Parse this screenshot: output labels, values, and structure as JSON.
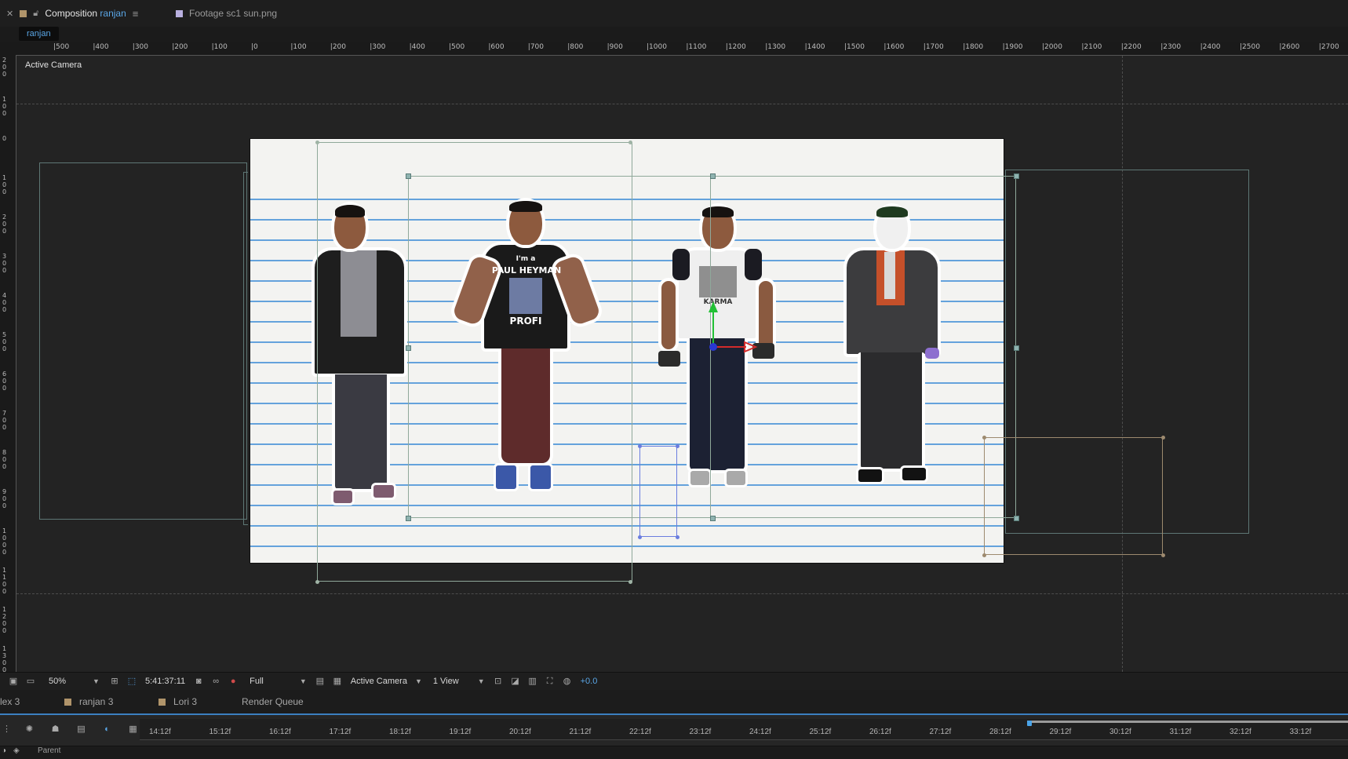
{
  "tabs": {
    "composition": {
      "prefix": "Composition",
      "name": "ranjan",
      "color": "#b0946a"
    },
    "footage": {
      "label": "Footage sc1 sun.png",
      "color": "#b9b0e0"
    }
  },
  "breadcrumb": "ranjan",
  "viewer": {
    "camera_label": "Active Camera",
    "hruler_labels": [
      "500",
      "400",
      "300",
      "200",
      "100",
      "0",
      "100",
      "200",
      "300",
      "400",
      "500",
      "600",
      "700",
      "800",
      "900",
      "1000",
      "1100",
      "1200",
      "1300",
      "1400",
      "1500",
      "1600",
      "1700",
      "1800",
      "1900",
      "2000",
      "2100",
      "2200",
      "2300",
      "2400",
      "2500",
      "2600",
      "2700"
    ],
    "vruler_labels": [
      "200",
      "100",
      "0",
      "100",
      "200",
      "300",
      "400",
      "500",
      "600",
      "700",
      "800",
      "900",
      "1000",
      "1100",
      "1200",
      "1300"
    ],
    "shirt_lines": [
      "I'm a",
      "PAUL HEYMAN",
      "PROFI"
    ],
    "shirt3_text": "KARMA"
  },
  "toolbar": {
    "zoom": "50%",
    "timecode": "5:41:37:11",
    "resolution": "Full",
    "camera": "Active Camera",
    "views": "1 View",
    "exposure": "+0.0"
  },
  "bottom_tabs": {
    "t0": "lex 3",
    "t1": "ranjan 3",
    "t2": "Lori 3",
    "t3": "Render Queue",
    "t1_color": "#b0946a",
    "t2_color": "#b0946a"
  },
  "timeline": {
    "ticks": [
      "14:12f",
      "15:12f",
      "16:12f",
      "17:12f",
      "18:12f",
      "19:12f",
      "20:12f",
      "21:12f",
      "22:12f",
      "23:12f",
      "24:12f",
      "25:12f",
      "26:12f",
      "27:12f",
      "28:12f",
      "29:12f",
      "30:12f",
      "31:12f",
      "32:12f",
      "33:12f"
    ],
    "parent_label": "Parent"
  }
}
